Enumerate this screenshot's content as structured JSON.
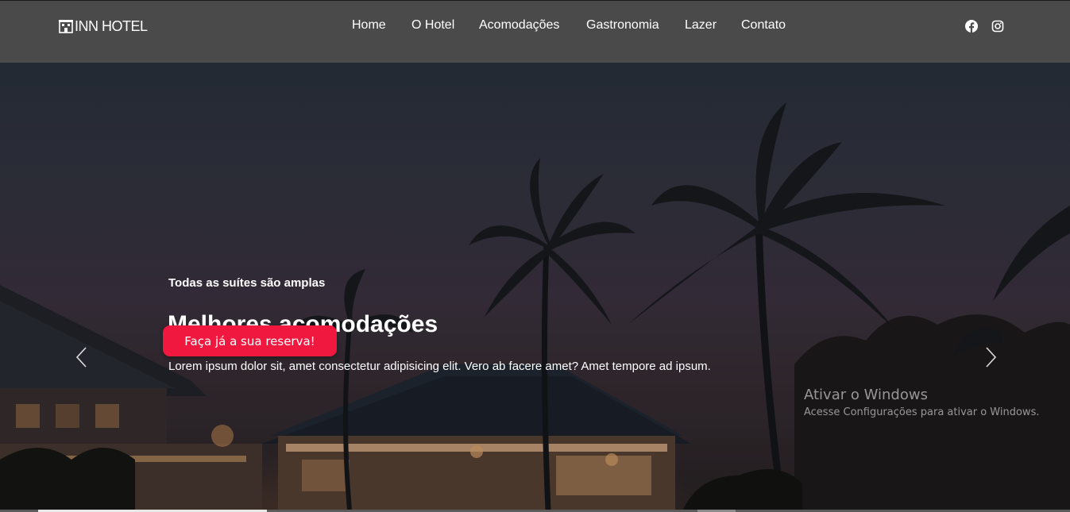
{
  "header": {
    "logo_text": "INN HOTEL",
    "nav": [
      "Home",
      "O Hotel",
      "Acomodações",
      "Gastronomia",
      "Lazer",
      "Contato"
    ],
    "social_icons": [
      "facebook-icon",
      "instagram-icon"
    ]
  },
  "hero": {
    "eyebrow": "Todas as suítes são amplas",
    "title": "Melhores acomodações",
    "text": "Lorem ipsum dolor sit, amet consectetur adipisicing elit. Vero ab facere amet? Amet tempore ad ipsum.",
    "cta_label": "Faça já a sua reserva!",
    "prev_icon": "chevron-left-icon",
    "next_icon": "chevron-right-icon"
  },
  "watermark": {
    "title": "Ativar o Windows",
    "subtitle": "Acesse Configurações para ativar o Windows."
  },
  "colors": {
    "header_bg": "#4a4a4a",
    "cta": "#f1183f"
  }
}
